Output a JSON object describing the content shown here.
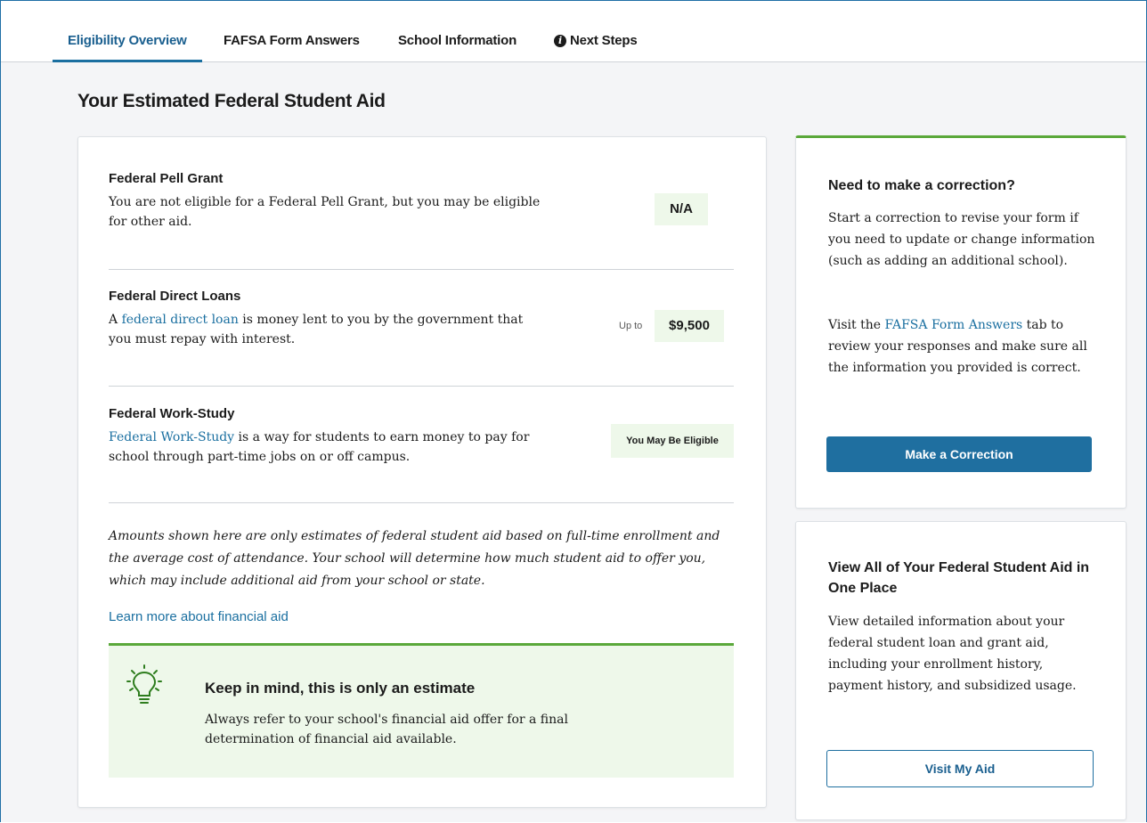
{
  "tabs": [
    {
      "label": "Eligibility Overview",
      "active": true
    },
    {
      "label": "FAFSA Form Answers",
      "active": false
    },
    {
      "label": "School Information",
      "active": false
    },
    {
      "label": "Next Steps",
      "active": false,
      "icon": "info-icon"
    }
  ],
  "page_title": "Your Estimated Federal Student Aid",
  "aid": {
    "pell": {
      "title": "Federal Pell Grant",
      "description": "You are not eligible for a Federal Pell Grant, but you may be eligible for other aid.",
      "value": "N/A"
    },
    "loans": {
      "title": "Federal Direct Loans",
      "desc_prefix": "A ",
      "desc_link": "federal direct loan",
      "desc_suffix": " is money lent to you by the government that you must repay with interest.",
      "upto_label": "Up to",
      "value": "$9,500"
    },
    "workstudy": {
      "title": "Federal Work-Study",
      "desc_link": "Federal Work-Study",
      "desc_suffix": " is a way for students to earn money to pay for school through part-time jobs on or off campus.",
      "value": "You May Be Eligible"
    }
  },
  "disclaimer": "Amounts shown here are only estimates of federal student aid based on full-time enrollment and the average cost of attendance. Your school will determine how much student aid to offer you, which may include additional aid from your school or state.",
  "learn_more": "Learn more about financial aid",
  "estimate": {
    "icon": "lightbulb-icon",
    "title": "Keep in mind, this is only an estimate",
    "text": "Always refer to your school's financial aid offer for a final determination of financial aid available."
  },
  "correction": {
    "title": "Need to make a correction?",
    "text1": "Start a correction to revise your form if you need to update or change information (such as adding an additional school).",
    "text2_prefix": "Visit the ",
    "text2_link": "FAFSA Form Answers",
    "text2_suffix": " tab to review your responses and make sure all the information you provided is correct.",
    "button": "Make a Correction"
  },
  "visit": {
    "title": "View All of Your Federal Student Aid in One Place",
    "text": "View detailed information about your federal student loan and grant aid, including your enrollment history, payment history, and subsidized usage.",
    "button": "Visit My Aid"
  },
  "colors": {
    "accent": "#1f6fa0",
    "success": "#5aa83a",
    "badge_bg": "#eef8ea"
  }
}
